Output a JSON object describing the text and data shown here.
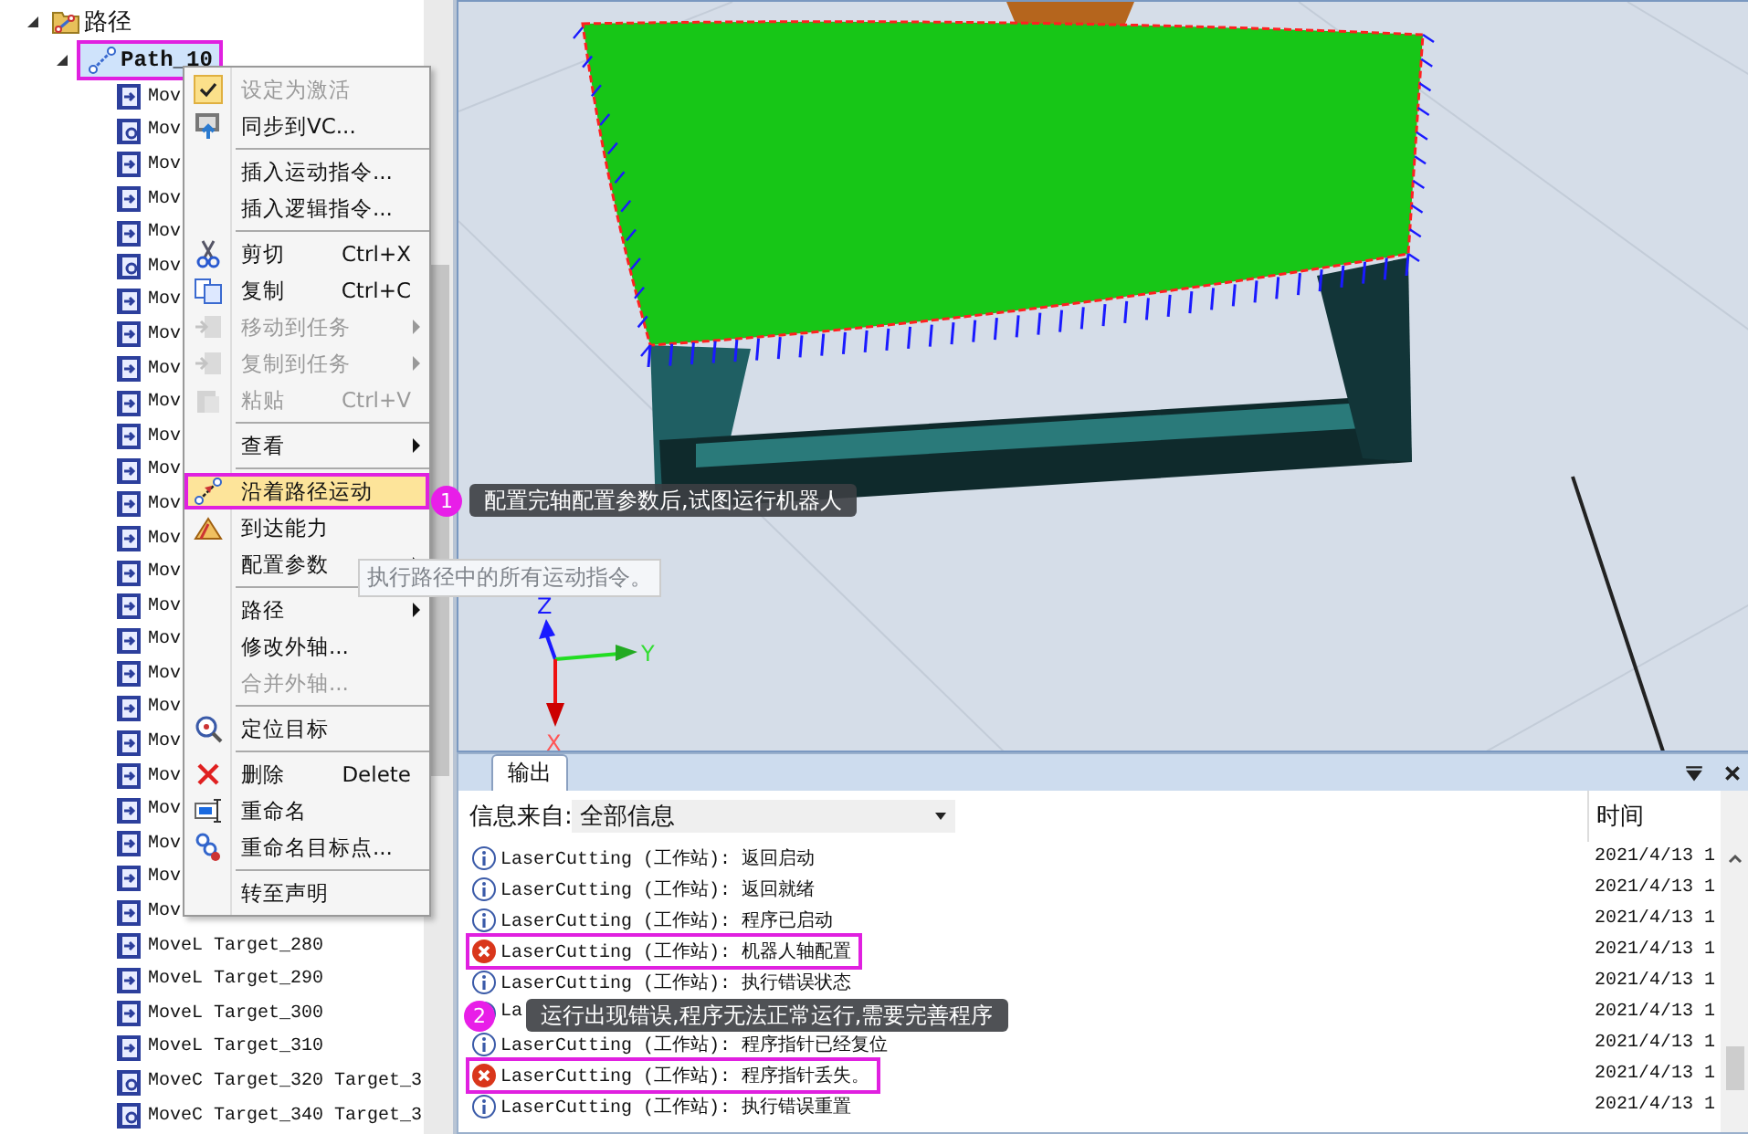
{
  "tree": {
    "label": "路径",
    "expanded": true,
    "children": [
      {
        "label": "Path_10",
        "expanded": true,
        "highlighted": true,
        "children": [
          {
            "kind": "movel",
            "label": "Mov"
          },
          {
            "kind": "movec",
            "label": "Mov"
          },
          {
            "kind": "movel",
            "label": "Mov"
          },
          {
            "kind": "movel",
            "label": "Mov"
          },
          {
            "kind": "movel",
            "label": "Mov"
          },
          {
            "kind": "movec",
            "label": "Mov"
          },
          {
            "kind": "movel",
            "label": "Mov"
          },
          {
            "kind": "movel",
            "label": "Mov"
          },
          {
            "kind": "movel",
            "label": "Mov"
          },
          {
            "kind": "movel",
            "label": "Mov"
          },
          {
            "kind": "movel",
            "label": "Mov"
          },
          {
            "kind": "movel",
            "label": "Mov"
          },
          {
            "kind": "movel",
            "label": "Mov"
          },
          {
            "kind": "movel",
            "label": "Mov"
          },
          {
            "kind": "movel",
            "label": "Mov"
          },
          {
            "kind": "movel",
            "label": "Mov"
          },
          {
            "kind": "movel",
            "label": "Mov"
          },
          {
            "kind": "movel",
            "label": "Mov"
          },
          {
            "kind": "movel",
            "label": "Mov"
          },
          {
            "kind": "movel",
            "label": "Mov"
          },
          {
            "kind": "movel",
            "label": "Mov"
          },
          {
            "kind": "movel",
            "label": "Mov"
          },
          {
            "kind": "movel",
            "label": "Mov"
          },
          {
            "kind": "movel",
            "label": "Mov"
          },
          {
            "kind": "movel",
            "label": "Mov"
          },
          {
            "kind": "movel",
            "label": "MoveL Target_280"
          },
          {
            "kind": "movel",
            "label": "MoveL Target_290"
          },
          {
            "kind": "movel",
            "label": "MoveL Target_300"
          },
          {
            "kind": "movel",
            "label": "MoveL Target_310"
          },
          {
            "kind": "movec",
            "label": "MoveC Target_320 Target_3"
          },
          {
            "kind": "movec",
            "label": "MoveC Target_340 Target_3"
          }
        ]
      }
    ]
  },
  "context_menu": {
    "groups": [
      [
        {
          "label": "设定为激活",
          "disabled": true,
          "checked": true,
          "highlighted": false,
          "submenu": false
        },
        {
          "label": "同步到VC...",
          "disabled": false,
          "checked": false,
          "highlighted": false,
          "submenu": false
        }
      ],
      [
        {
          "label": "插入运动指令...",
          "disabled": false,
          "checked": false,
          "highlighted": false,
          "submenu": false
        },
        {
          "label": "插入逻辑指令...",
          "disabled": false,
          "checked": false,
          "highlighted": false,
          "submenu": false
        }
      ],
      [
        {
          "label": "剪切",
          "shortcut": "Ctrl+X",
          "disabled": false,
          "checked": false,
          "highlighted": false,
          "submenu": false
        },
        {
          "label": "复制",
          "shortcut": "Ctrl+C",
          "disabled": false,
          "checked": false,
          "highlighted": false,
          "submenu": false
        },
        {
          "label": "移动到任务",
          "disabled": true,
          "checked": false,
          "highlighted": false,
          "submenu": true
        },
        {
          "label": "复制到任务",
          "disabled": true,
          "checked": false,
          "highlighted": false,
          "submenu": true
        },
        {
          "label": "粘贴",
          "shortcut": "Ctrl+V",
          "disabled": true,
          "checked": false,
          "highlighted": false,
          "submenu": false
        }
      ],
      [
        {
          "label": "查看",
          "disabled": false,
          "checked": false,
          "highlighted": false,
          "submenu": true
        }
      ],
      [
        {
          "label": "沿着路径运动",
          "disabled": false,
          "checked": false,
          "highlighted": true,
          "submenu": false
        },
        {
          "label": "到达能力",
          "disabled": false,
          "checked": false,
          "highlighted": false,
          "submenu": false
        },
        {
          "label": "配置参数",
          "disabled": false,
          "checked": false,
          "highlighted": false,
          "submenu": true
        }
      ],
      [
        {
          "label": "路径",
          "disabled": false,
          "checked": false,
          "highlighted": false,
          "submenu": true
        },
        {
          "label": "修改外轴...",
          "disabled": false,
          "checked": false,
          "highlighted": false,
          "submenu": false
        },
        {
          "label": "合并外轴...",
          "disabled": true,
          "checked": false,
          "highlighted": false,
          "submenu": false
        }
      ],
      [
        {
          "label": "定位目标",
          "disabled": false,
          "checked": false,
          "highlighted": false,
          "submenu": false
        }
      ],
      [
        {
          "label": "删除",
          "shortcut": "Delete",
          "disabled": false,
          "checked": false,
          "highlighted": false,
          "submenu": false
        },
        {
          "label": "重命名",
          "disabled": false,
          "checked": false,
          "highlighted": false,
          "submenu": false
        },
        {
          "label": "重命名目标点...",
          "disabled": false,
          "checked": false,
          "highlighted": false,
          "submenu": false
        }
      ],
      [
        {
          "label": "转至声明",
          "disabled": false,
          "checked": false,
          "highlighted": false,
          "submenu": false
        }
      ]
    ]
  },
  "menu_tooltip": "执行路径中的所有运动指令。",
  "viewport": {
    "axes": [
      "Z",
      "Y",
      "X"
    ]
  },
  "output": {
    "tab": "输出",
    "filter_label": "信息来自:",
    "filter_value": "全部信息",
    "time_header": "时间",
    "rows": [
      {
        "kind": "info",
        "message": "LaserCutting (工作站): 返回启动",
        "time": "2021/4/13 1",
        "highlighted": false
      },
      {
        "kind": "info",
        "message": "LaserCutting (工作站): 返回就绪",
        "time": "2021/4/13 1",
        "highlighted": false
      },
      {
        "kind": "info",
        "message": "LaserCutting (工作站): 程序已启动",
        "time": "2021/4/13 1",
        "highlighted": false
      },
      {
        "kind": "error",
        "message": "LaserCutting (工作站): 机器人轴配置",
        "time": "2021/4/13 1",
        "highlighted": true
      },
      {
        "kind": "info",
        "message": "LaserCutting (工作站): 执行错误状态",
        "time": "2021/4/13 1",
        "highlighted": false
      },
      {
        "kind": "info",
        "message": "La",
        "time": "2021/4/13 1",
        "highlighted": false
      },
      {
        "kind": "info",
        "message": "LaserCutting (工作站): 程序指针已经复位",
        "time": "2021/4/13 1",
        "highlighted": false
      },
      {
        "kind": "error",
        "message": "LaserCutting (工作站): 程序指针丢失。",
        "time": "2021/4/13 1",
        "highlighted": true
      },
      {
        "kind": "info",
        "message": "LaserCutting (工作站): 执行错误重置",
        "time": "2021/4/13 1",
        "highlighted": false
      }
    ]
  },
  "annotations": [
    {
      "number": "1",
      "text": "配置完轴配置参数后,试图运行机器人"
    },
    {
      "number": "2",
      "text": "运行出现错误,程序无法正常运行,需要完善程序"
    }
  ]
}
